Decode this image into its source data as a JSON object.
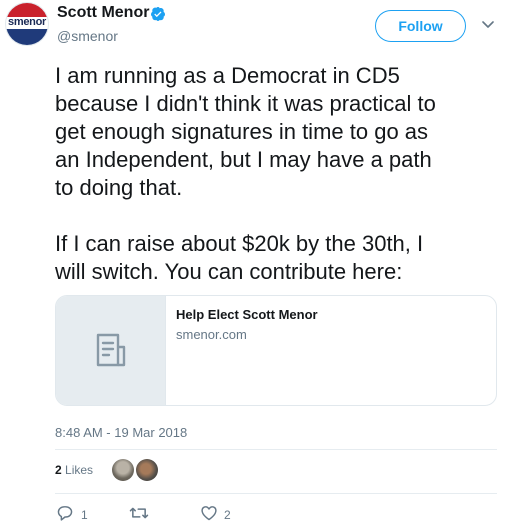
{
  "author": {
    "avatar_text": "smenor",
    "name": "Scott Menor",
    "handle": "@smenor",
    "verified": true
  },
  "follow_button": {
    "label": "Follow"
  },
  "tweet": {
    "text": "I am running as a Democrat in CD5\nbecause I didn't think it was practical to\nget enough signatures in time to go as\nan Independent, but I may have a path\nto doing that.\n\nIf I can raise about $20k by the 30th, I\nwill switch. You can contribute here:"
  },
  "link_card": {
    "title": "Help Elect Scott Menor",
    "domain": "smenor.com",
    "icon": "document-icon"
  },
  "timestamp": "8:48 AM - 19 Mar 2018",
  "likes": {
    "count": "2",
    "label": "Likes"
  },
  "actions": {
    "reply_count": "1",
    "retweet_count": "",
    "like_count": "2"
  },
  "colors": {
    "accent": "#1da1f2",
    "text": "#14171a",
    "secondary": "#657786",
    "border": "#e1e8ed"
  }
}
